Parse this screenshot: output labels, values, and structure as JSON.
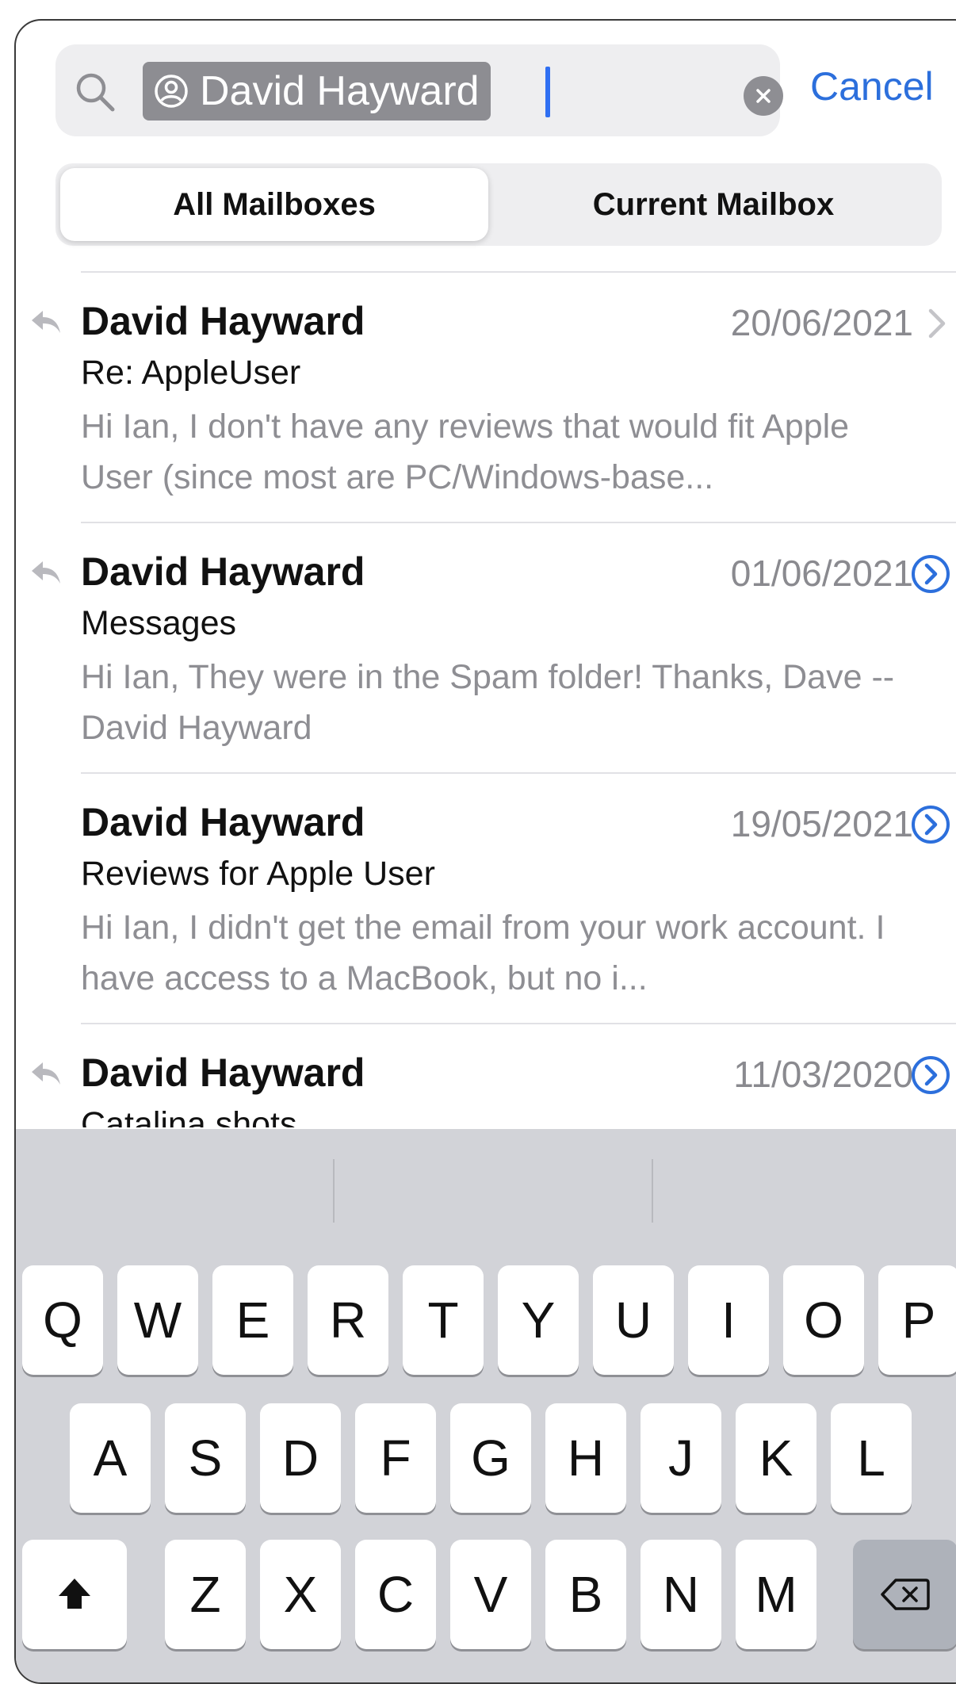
{
  "search": {
    "token_text": "David Hayward",
    "cancel_label": "Cancel"
  },
  "scope": {
    "options": [
      "All Mailboxes",
      "Current Mailbox"
    ],
    "selected": "All Mailboxes"
  },
  "messages": [
    {
      "sender": "David Hayward",
      "date": "20/06/2021",
      "subject": "Re: AppleUser",
      "preview": "Hi Ian, I don't have any reviews that would fit Apple User (since most are PC/Windows-base...",
      "replied": true,
      "accessory": "chevron-right-icon"
    },
    {
      "sender": "David Hayward",
      "date": "01/06/2021",
      "subject": "Messages",
      "preview": "Hi Ian, They were in the Spam folder! Thanks, Dave -- David Hayward",
      "replied": true,
      "accessory": "thread-chevron-circle-icon"
    },
    {
      "sender": "David Hayward",
      "date": "19/05/2021",
      "subject": "Reviews for Apple User",
      "preview": "Hi Ian, I didn't get the email from your work account. I have access to a MacBook, but no i...",
      "replied": false,
      "accessory": "thread-chevron-circle-icon"
    },
    {
      "sender": "David Hayward",
      "date": "11/03/2020",
      "subject": "Catalina shots",
      "preview": "",
      "replied": true,
      "accessory": "thread-chevron-circle-icon"
    }
  ],
  "keyboard": {
    "row1": [
      "Q",
      "W",
      "E",
      "R",
      "T",
      "Y",
      "U",
      "I",
      "O",
      "P"
    ],
    "row2": [
      "A",
      "S",
      "D",
      "F",
      "G",
      "H",
      "J",
      "K",
      "L"
    ],
    "row3": [
      "Z",
      "X",
      "C",
      "V",
      "B",
      "N",
      "M"
    ],
    "shift_icon": "shift-arrow-icon",
    "delete_icon": "backspace-icon"
  },
  "colors": {
    "accent": "#2c6fdc",
    "secondary_text": "#8e8e93",
    "keyboard_bg": "#d2d3d8"
  }
}
